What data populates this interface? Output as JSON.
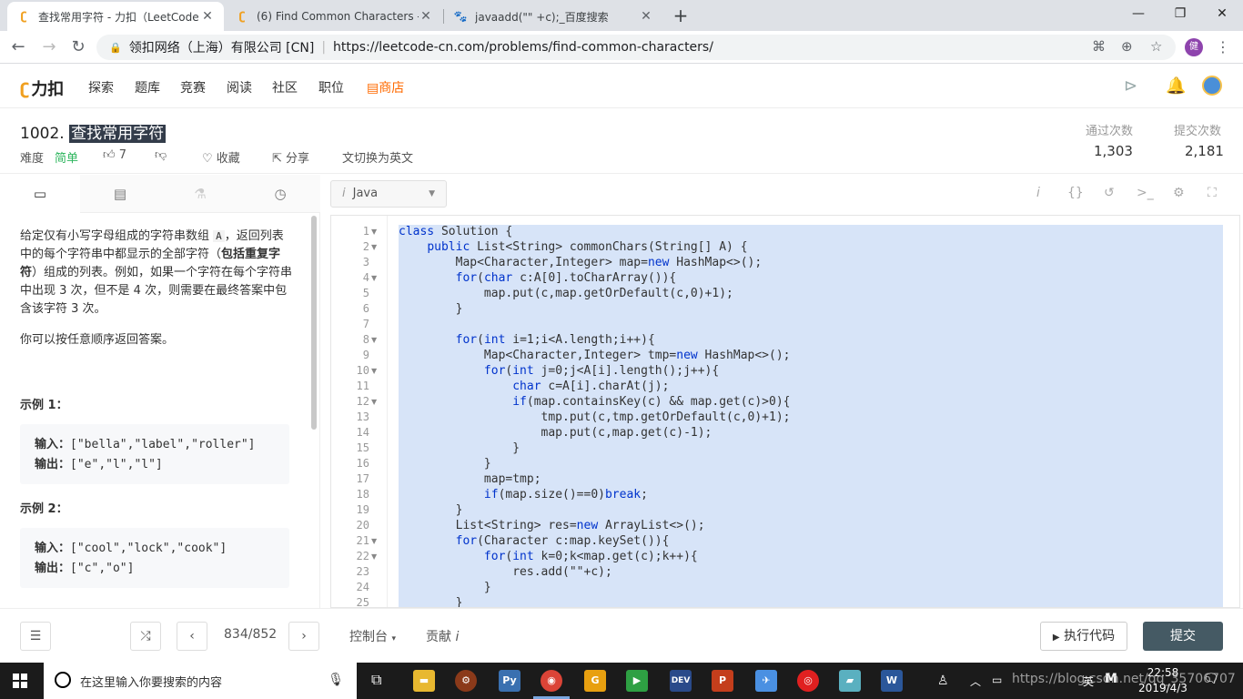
{
  "browser": {
    "tabs": [
      {
        "title": "查找常用字符 - 力扣（LeetCode",
        "active": true
      },
      {
        "title": "(6) Find Common Characters -",
        "active": false
      },
      {
        "title": "javaadd(\"\" +c);_百度搜索",
        "active": false
      }
    ],
    "address": {
      "org": "领扣网络（上海）有限公司 [CN]",
      "url": "https://leetcode-cn.com/problems/find-common-characters/"
    },
    "profile_initial": "健"
  },
  "lc_header": {
    "logo": "力扣",
    "nav": [
      "探索",
      "题库",
      "竞赛",
      "阅读",
      "社区",
      "职位"
    ],
    "store": "商店"
  },
  "problem": {
    "number": "1002.",
    "title": "查找常用字符",
    "difficulty_label": "难度",
    "difficulty": "简单",
    "likes": "7",
    "favorite": "收藏",
    "share": "分享",
    "switch_lang": "切换为英文",
    "accepted_label": "通过次数",
    "accepted": "1,303",
    "submissions_label": "提交次数",
    "submissions": "2,181"
  },
  "description": {
    "p1_a": "给定仅有小写字母组成的字符串数组 ",
    "p1_code": "A",
    "p1_b": "，返回列表中的每个字符串中都显示的全部字符（",
    "p1_bold": "包括重复字符",
    "p1_c": "）组成的列表。例如，如果一个字符在每个字符串中出现 3 次，但不是 4 次，则需要在最终答案中包含该字符 3 次。",
    "p2": "你可以按任意顺序返回答案。",
    "example1_title": "示例 1：",
    "example1_input_label": "输入：",
    "example1_input": "[\"bella\",\"label\",\"roller\"]",
    "example1_output_label": "输出：",
    "example1_output": "[\"e\",\"l\",\"l\"]",
    "example2_title": "示例 2：",
    "example2_input_label": "输入：",
    "example2_input": "[\"cool\",\"lock\",\"cook\"]",
    "example2_output_label": "输出：",
    "example2_output": "[\"c\",\"o\"]"
  },
  "editor": {
    "language": "Java",
    "lines": [
      {
        "n": "1",
        "fold": true,
        "code": "class Solution {"
      },
      {
        "n": "2",
        "fold": true,
        "code": "    public List<String> commonChars(String[] A) {"
      },
      {
        "n": "3",
        "fold": false,
        "code": "        Map<Character,Integer> map=new HashMap<>();"
      },
      {
        "n": "4",
        "fold": true,
        "code": "        for(char c:A[0].toCharArray()){"
      },
      {
        "n": "5",
        "fold": false,
        "code": "            map.put(c,map.getOrDefault(c,0)+1);"
      },
      {
        "n": "6",
        "fold": false,
        "code": "        }"
      },
      {
        "n": "7",
        "fold": false,
        "code": ""
      },
      {
        "n": "8",
        "fold": true,
        "code": "        for(int i=1;i<A.length;i++){"
      },
      {
        "n": "9",
        "fold": false,
        "code": "            Map<Character,Integer> tmp=new HashMap<>();"
      },
      {
        "n": "10",
        "fold": true,
        "code": "            for(int j=0;j<A[i].length();j++){"
      },
      {
        "n": "11",
        "fold": false,
        "code": "                char c=A[i].charAt(j);"
      },
      {
        "n": "12",
        "fold": true,
        "code": "                if(map.containsKey(c) && map.get(c)>0){"
      },
      {
        "n": "13",
        "fold": false,
        "code": "                    tmp.put(c,tmp.getOrDefault(c,0)+1);"
      },
      {
        "n": "14",
        "fold": false,
        "code": "                    map.put(c,map.get(c)-1);"
      },
      {
        "n": "15",
        "fold": false,
        "code": "                }"
      },
      {
        "n": "16",
        "fold": false,
        "code": "            }"
      },
      {
        "n": "17",
        "fold": false,
        "code": "            map=tmp;"
      },
      {
        "n": "18",
        "fold": false,
        "code": "            if(map.size()==0)break;"
      },
      {
        "n": "19",
        "fold": false,
        "code": "        }"
      },
      {
        "n": "20",
        "fold": false,
        "code": "        List<String> res=new ArrayList<>();"
      },
      {
        "n": "21",
        "fold": true,
        "code": "        for(Character c:map.keySet()){"
      },
      {
        "n": "22",
        "fold": true,
        "code": "            for(int k=0;k<map.get(c);k++){"
      },
      {
        "n": "23",
        "fold": false,
        "code": "                res.add(\"\"+c);"
      },
      {
        "n": "24",
        "fold": false,
        "code": "            }"
      },
      {
        "n": "25",
        "fold": false,
        "code": "        }"
      }
    ]
  },
  "bottom": {
    "pager": "834/852",
    "console": "控制台",
    "contribute": "贡献",
    "run": "执行代码",
    "submit": "提交"
  },
  "taskbar": {
    "search_placeholder": "在这里输入你要搜索的内容",
    "ime": "英",
    "time": "22:58",
    "date": "2019/4/3",
    "watermark": "https://blog.csdn.net/qq_35706707"
  },
  "colors": {
    "accent_orange": "#ff6a00",
    "easy_green": "#2db55d",
    "selection": "#d7e4f8",
    "submit_bg": "#455a64"
  }
}
